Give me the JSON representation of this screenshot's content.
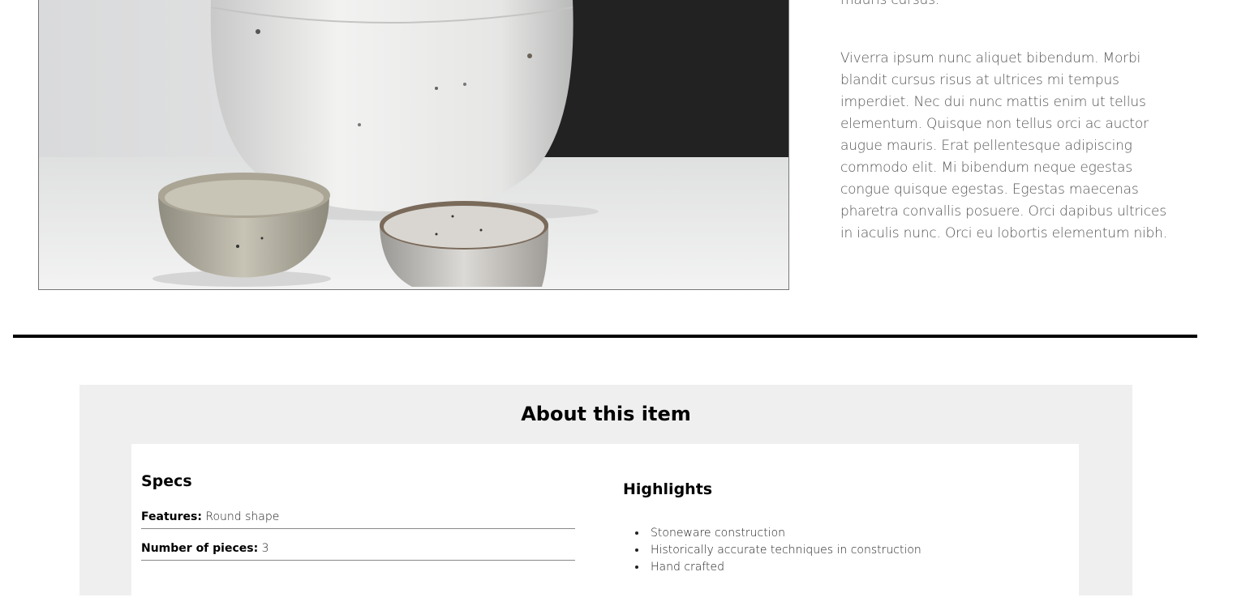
{
  "product": {
    "image_alt": "Three ceramic bowls",
    "description_partial": "mauris cursus.",
    "description": "Viverra ipsum nunc aliquet bibendum. Morbi blandit cursus risus at ultrices mi tempus imperdiet. Nec dui nunc mattis enim ut tellus elementum. Quisque non tellus orci ac auctor augue mauris. Erat pellentesque adipiscing commodo elit. Mi bibendum neque egestas congue quisque egestas. Egestas maecenas pharetra convallis posuere. Orci dapibus ultrices in iaculis nunc. Orci eu lobortis elementum nibh."
  },
  "about": {
    "title": "About this item",
    "specs": {
      "title": "Specs",
      "rows": [
        {
          "label": "Features:",
          "value": "Round shape"
        },
        {
          "label": "Number of pieces:",
          "value": "3"
        }
      ]
    },
    "highlights": {
      "title": "Highlights",
      "items": [
        "Stoneware construction",
        "Historically accurate techniques in construction",
        "Hand crafted"
      ]
    }
  }
}
